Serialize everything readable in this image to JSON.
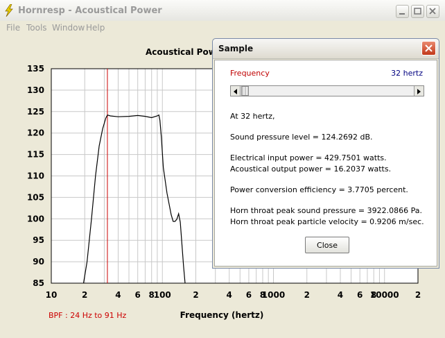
{
  "window": {
    "title": "Hornresp - Acoustical Power",
    "menu": [
      "File",
      "Tools",
      "Window",
      "Help"
    ]
  },
  "chart_data": {
    "type": "line",
    "title": "Acoustical Power",
    "xlabel": "Frequency (hertz)",
    "ylabel": "",
    "x_scale": "log",
    "xlim": [
      10,
      20000
    ],
    "ylim": [
      85,
      135
    ],
    "y_ticks": [
      85,
      90,
      95,
      100,
      105,
      110,
      115,
      120,
      125,
      130,
      135
    ],
    "x_tick_labels": [
      {
        "x": 10,
        "label": "10"
      },
      {
        "x": 20,
        "label": "2"
      },
      {
        "x": 40,
        "label": "4"
      },
      {
        "x": 60,
        "label": "6"
      },
      {
        "x": 80,
        "label": "8"
      },
      {
        "x": 100,
        "label": "100"
      },
      {
        "x": 200,
        "label": "2"
      },
      {
        "x": 400,
        "label": "4"
      },
      {
        "x": 600,
        "label": "6"
      },
      {
        "x": 800,
        "label": "8"
      },
      {
        "x": 1000,
        "label": "1000"
      },
      {
        "x": 2000,
        "label": "2"
      },
      {
        "x": 4000,
        "label": "4"
      },
      {
        "x": 6000,
        "label": "6"
      },
      {
        "x": 8000,
        "label": "8"
      },
      {
        "x": 10000,
        "label": "10000"
      },
      {
        "x": 20000,
        "label": "2"
      }
    ],
    "grid": true,
    "series": [
      {
        "name": "",
        "x": [
          19.5,
          21,
          23,
          25,
          27,
          29,
          31,
          32,
          34,
          40,
          50,
          60,
          70,
          80,
          90,
          93,
          95,
          98,
          102,
          110,
          120,
          125,
          130,
          135,
          140,
          145,
          150,
          155,
          160
        ],
        "y": [
          85,
          90,
          100,
          110,
          117,
          121,
          123.5,
          124.2,
          124.0,
          123.8,
          123.9,
          124.1,
          123.9,
          123.6,
          124.0,
          124.2,
          123.0,
          119,
          112,
          106,
          101,
          99.4,
          99.4,
          99.9,
          101.2,
          99.2,
          94,
          89,
          85
        ]
      }
    ],
    "marker_line": {
      "x": 32
    },
    "footnote": "BPF : 24 Hz to 91 Hz"
  },
  "dialog": {
    "title": "Sample",
    "frequency_label": "Frequency",
    "frequency_value": "32 hertz",
    "slider_fraction": 0.0,
    "lines": [
      "At 32 hertz,",
      "Sound pressure level = 124.2692 dB.",
      "Electrical input power = 429.7501 watts.",
      "Acoustical output power = 16.2037 watts.",
      "Power conversion efficiency = 3.7705 percent.",
      "Horn throat peak sound pressure = 3922.0866 Pa.",
      "Horn throat peak particle velocity = 0.9206 m/sec."
    ],
    "close_label": "Close"
  },
  "colors": {
    "marker": "#cc0000",
    "curve": "#000000",
    "grid": "#c8c8c8",
    "footnote": "#cc0000",
    "axis_text": "#000000"
  },
  "icons": [
    "app-lightning-icon",
    "minimize-icon",
    "maximize-icon",
    "close-icon",
    "scroll-left-icon",
    "scroll-right-icon"
  ]
}
